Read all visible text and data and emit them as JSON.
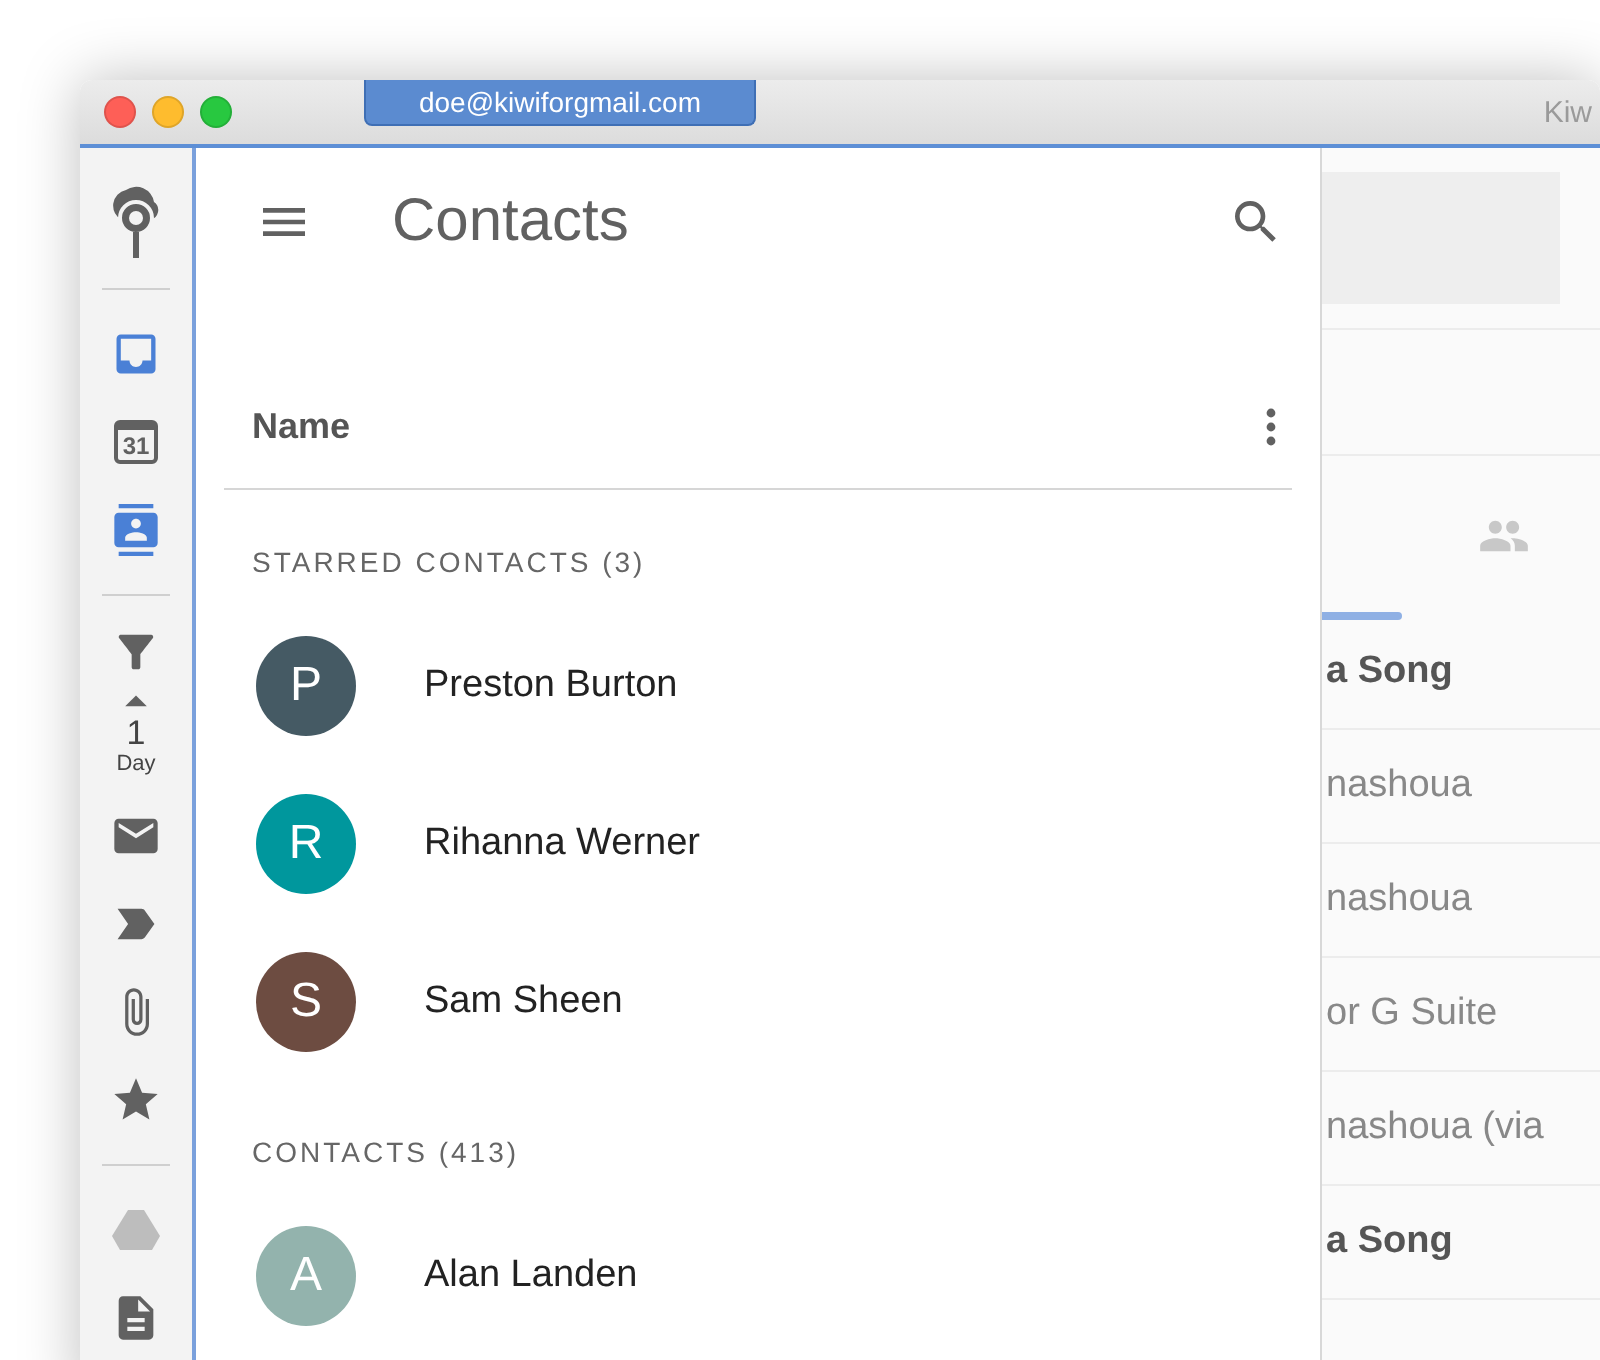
{
  "window": {
    "account": "doe@kiwiforgmail.com",
    "title": "Kiw"
  },
  "sidebar": {
    "calendar_day": "31",
    "range_value": "1",
    "range_unit": "Day"
  },
  "contacts_panel": {
    "title": "Contacts",
    "sort_label": "Name",
    "sections": [
      {
        "heading": "STARRED CONTACTS (3)",
        "contacts": [
          {
            "initial": "P",
            "name": "Preston Burton",
            "color": "#455a64"
          },
          {
            "initial": "R",
            "name": "Rihanna Werner",
            "color": "#00979d"
          },
          {
            "initial": "S",
            "name": "Sam Sheen",
            "color": "#6d4c41"
          }
        ]
      },
      {
        "heading": "CONTACTS (413)",
        "contacts": [
          {
            "initial": "A",
            "name": "Alan Landen",
            "color": "#93b3ad"
          }
        ]
      }
    ]
  },
  "mail_list": {
    "rows": [
      {
        "sender": "a Song",
        "unread": true
      },
      {
        "sender": "nashoua",
        "unread": false
      },
      {
        "sender": "nashoua",
        "unread": false
      },
      {
        "sender": "or G Suite",
        "unread": false
      },
      {
        "sender": "nashoua (via",
        "unread": false
      },
      {
        "sender": "a Song",
        "unread": true
      }
    ]
  }
}
